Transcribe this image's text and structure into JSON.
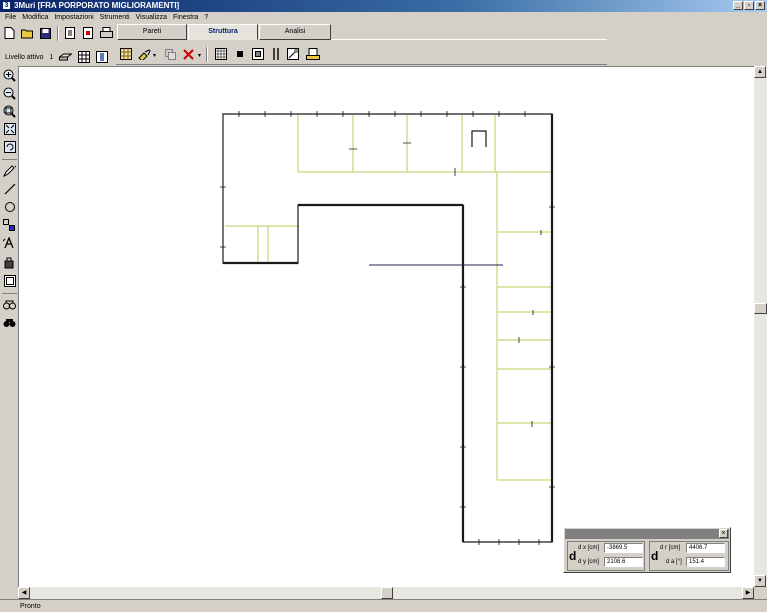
{
  "window": {
    "app_name": "3Muri",
    "document": "[FRA PORPORATO MIGLIORAMENTI]"
  },
  "menu": [
    "File",
    "Modifica",
    "Impostazioni",
    "Strumenti",
    "Visualizza",
    "Finestra",
    "?"
  ],
  "tabs": [
    {
      "label": "Pareti",
      "active": false
    },
    {
      "label": "Struttura",
      "active": true
    },
    {
      "label": "Analisi",
      "active": false
    }
  ],
  "level": {
    "label": "Livello attivo",
    "value": "1"
  },
  "coords": {
    "d_big_left": "d",
    "d_big_right": "d",
    "dx_label": "d x [cm]",
    "dx_value": "-3869.5",
    "dy_label": "d y [cm]",
    "dy_value": "2108.6",
    "dr_label": "d r [cm]",
    "dr_value": "4406.7",
    "da_label": "d a [°]",
    "da_value": "151.4"
  },
  "status": {
    "text": "Pronto"
  },
  "colors": {
    "wall": "#1a1a1a",
    "partition": "#c8d67a",
    "panel_title": "#808080",
    "titlebar": "#0a246a"
  }
}
